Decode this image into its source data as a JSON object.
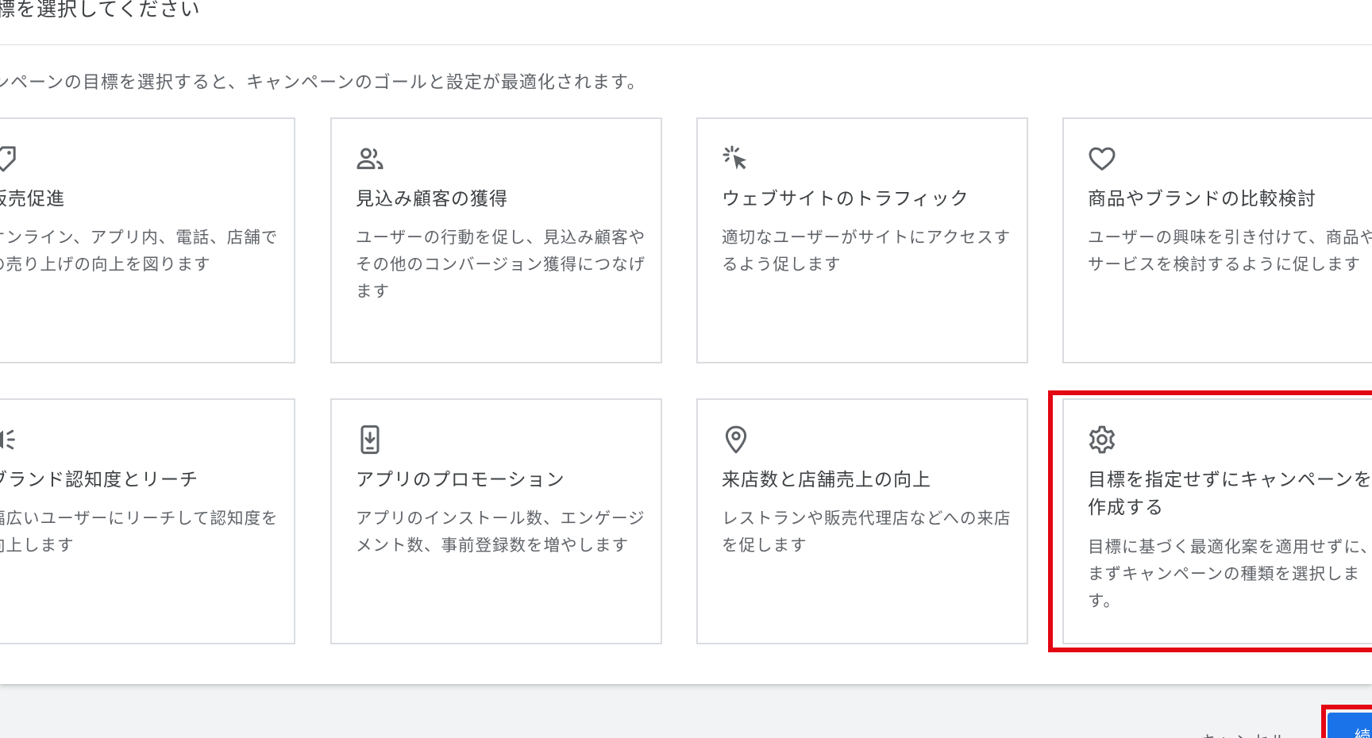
{
  "dialog": {
    "title": "標を選択してください",
    "description": "ンペーンの目標を選択すると、キャンペーンのゴールと設定が最適化されます。"
  },
  "goals": [
    {
      "icon": "tag-icon",
      "title": "販売促進",
      "description": "オンライン、アプリ内、電話、店舗での売り上げの向上を図ります"
    },
    {
      "icon": "people-icon",
      "title": "見込み顧客の獲得",
      "description": "ユーザーの行動を促し、見込み顧客やその他のコンバージョン獲得につなげます"
    },
    {
      "icon": "cursor-click-icon",
      "title": "ウェブサイトのトラフィック",
      "description": "適切なユーザーがサイトにアクセスするよう促します"
    },
    {
      "icon": "heart-icon",
      "title": "商品やブランドの比較検討",
      "description": "ユーザーの興味を引き付けて、商品やサービスを検討するように促します"
    },
    {
      "icon": "megaphone-icon",
      "title": "ブランド認知度とリーチ",
      "description": "幅広いユーザーにリーチして認知度を向上します"
    },
    {
      "icon": "phone-download-icon",
      "title": "アプリのプロモーション",
      "description": "アプリのインストール数、エンゲージメント数、事前登録数を増やします"
    },
    {
      "icon": "location-pin-icon",
      "title": "来店数と店舗売上の向上",
      "description": "レストランや販売代理店などへの来店を促します"
    },
    {
      "icon": "gear-icon",
      "title": "目標を指定せずにキャンペーンを作成する",
      "description": "目標に基づく最適化案を適用せずに、まずキャンペーンの種類を選択します。"
    }
  ],
  "footer": {
    "cancel_label": "キャンセル",
    "continue_label": "続"
  },
  "colors": {
    "highlight": "#e30613",
    "primary_button": "#1a73e8",
    "card_border": "#dadce0"
  }
}
